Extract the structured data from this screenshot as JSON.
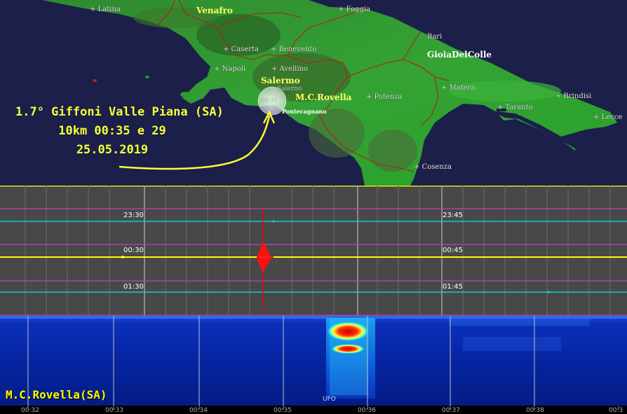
{
  "map": {
    "cities": [
      {
        "id": "latina",
        "label": "+ Latina"
      },
      {
        "id": "foggia",
        "label": "+ Foggia"
      },
      {
        "id": "bari",
        "label": "Bari"
      },
      {
        "id": "caserta",
        "label": "+ Caserta"
      },
      {
        "id": "benevento",
        "label": "+ Benevento"
      },
      {
        "id": "napoli",
        "label": "+ Napoli"
      },
      {
        "id": "avellino",
        "label": "+ Avellino"
      },
      {
        "id": "salerno-city",
        "label": "Salerno"
      },
      {
        "id": "potenza",
        "label": "+ Potenza"
      },
      {
        "id": "matera",
        "label": "+ Matera"
      },
      {
        "id": "brindisi",
        "label": "+ Brindisi"
      },
      {
        "id": "taranto",
        "label": "+ Taranto"
      },
      {
        "id": "lecce",
        "label": "+ Lecce"
      },
      {
        "id": "cosenza",
        "label": "+ Cosenza"
      }
    ],
    "stations": {
      "venafro": "Venafro",
      "salermo": "Salermo",
      "mcrovella": "M.C.Rovella",
      "gioia": "GioiaDelColle",
      "pontecagnano": "Pontecagnano"
    },
    "epicenter_marker_label": "00:35",
    "quake": {
      "line1": "1.7° Giffoni Valle Piana (SA)",
      "line2": "10km 00:35 e 29",
      "line3": "25.05.2019"
    },
    "colors": {
      "sea": "#1b1f4a",
      "land": "#2e9a2e",
      "borders": "#b02020",
      "annotation": "#ffff33"
    }
  },
  "seismogram": {
    "row_labels_left": [
      "23:30",
      "00:30",
      "01:30"
    ],
    "row_labels_right": [
      "23:45",
      "00:45",
      "01:45"
    ],
    "colors": {
      "background": "#484848",
      "cyan": "#00e8e8",
      "yellow": "#ffff00",
      "magenta": "#c040c0",
      "event": "#ff0000"
    }
  },
  "spectrogram": {
    "brand": "M.C.Rovella(SA)",
    "ufo_label": "UFO",
    "time_ticks": [
      "00:32",
      "00:33",
      "00:34",
      "00:35",
      "00:36",
      "00:37",
      "00:38",
      "00:3"
    ]
  }
}
